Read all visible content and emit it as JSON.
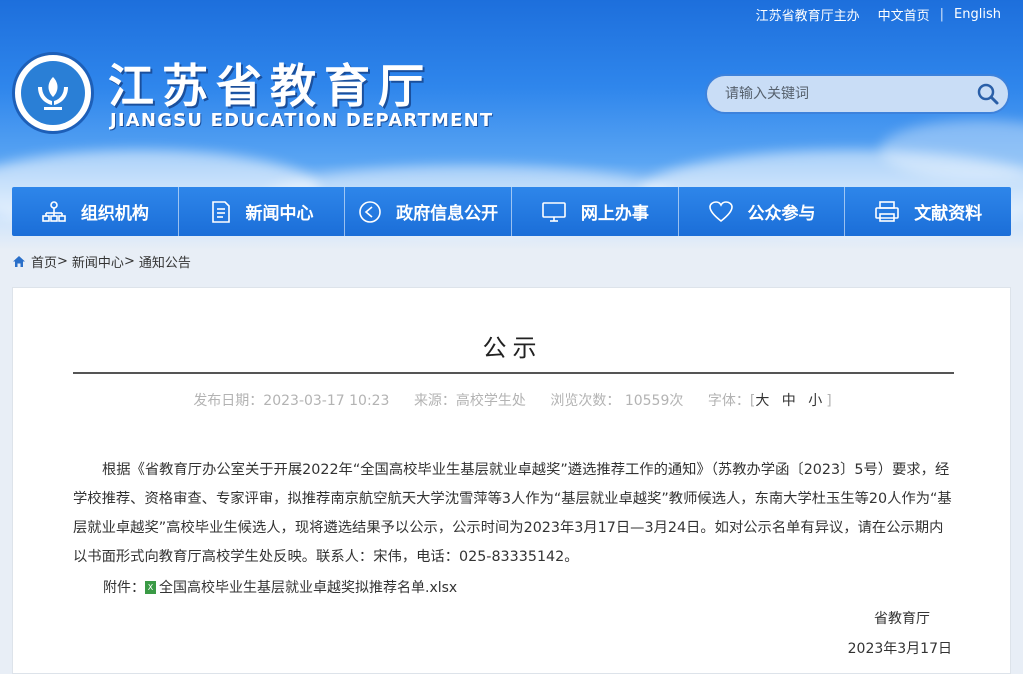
{
  "top_links": {
    "sponsor": "江苏省教育厅主办",
    "home": "中文首页",
    "english": "English"
  },
  "site": {
    "title": "江苏省教育厅",
    "subtitle": "JIANGSU EDUCATION DEPARTMENT"
  },
  "search": {
    "placeholder": "请输入关键词"
  },
  "nav": [
    {
      "label": "组织机构",
      "icon": "org-chart-icon"
    },
    {
      "label": "新闻中心",
      "icon": "document-icon"
    },
    {
      "label": "政府信息公开",
      "icon": "play-circle-icon"
    },
    {
      "label": "网上办事",
      "icon": "monitor-icon"
    },
    {
      "label": "公众参与",
      "icon": "heart-icon"
    },
    {
      "label": "文献资料",
      "icon": "printer-icon"
    }
  ],
  "breadcrumb": {
    "home": "首页",
    "sep1": ">",
    "news": "新闻中心",
    "sep2": ">",
    "current": "通知公告"
  },
  "article": {
    "title": "公示",
    "publish_date": "发布日期：2023-03-17 10:23",
    "source": "来源：高校学生处",
    "views": "浏览次数：  10559次",
    "font_label": "字体：",
    "font_bracket_open": "[",
    "font_sizes": "大 中 小",
    "font_bracket_close": "]",
    "body": "根据《省教育厅办公室关于开展2022年“全国高校毕业生基层就业卓越奖”遴选推荐工作的通知》（苏教办学函〔2023〕5号）要求，经学校推荐、资格审查、专家评审，拟推荐南京航空航天大学沈雪萍等3人作为“基层就业卓越奖”教师候选人，东南大学杜玉生等20人作为“基层就业卓越奖”高校毕业生候选人，现将遴选结果予以公示，公示时间为2023年3月17日—3月24日。如对公示名单有异议，请在公示期内以书面形式向教育厅高校学生处反映。联系人：宋伟，电话：025-83335142。",
    "attachment_label": "附件：",
    "attachment_name": "全国高校毕业生基层就业卓越奖拟推荐名单.xlsx",
    "signature": "省教育厅",
    "date": "2023年3月17日"
  }
}
